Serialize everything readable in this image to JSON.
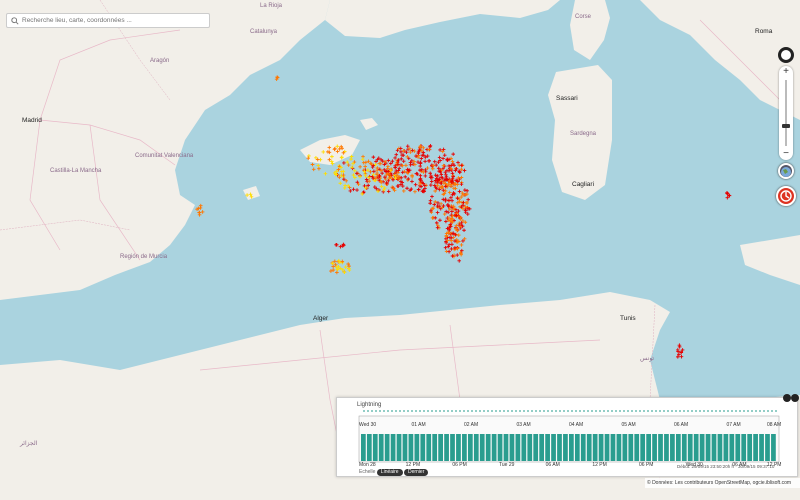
{
  "search": {
    "placeholder": "Recherche lieu, carte, coordonnées ..."
  },
  "map": {
    "labels": {
      "la_rioja": "La Rioja",
      "catalunya": "Catalunya",
      "aragon": "Aragón",
      "madrid": "Madrid",
      "comunitat": "Comunitat Valenciana",
      "castilla": "Castilla-La Mancha",
      "murcia": "Región de Murcia",
      "corse": "Corse",
      "roma": "Roma",
      "sassari": "Sassari",
      "sardegna": "Sardegna",
      "cagliari": "Cagliari",
      "alger": "Alger",
      "tunis": "Tunis",
      "tunisie": "تونس",
      "algerie": "الجزائر"
    },
    "colors": {
      "sea": "#aad3df",
      "land": "#f2efe9",
      "strike_red": "#e60000",
      "strike_orange": "#ff7700",
      "strike_yellow": "#ffdd00"
    }
  },
  "lightning_panel": {
    "title": "Lightning",
    "top_axis": [
      "Wed 30",
      "01 AM",
      "02 AM",
      "03 AM",
      "04 AM",
      "05 AM",
      "06 AM",
      "07 AM",
      "08 AM"
    ],
    "bottom_axis": [
      "Mon 28",
      "12 PM",
      "06 PM",
      "Tue 29",
      "06 AM",
      "12 PM",
      "06 PM",
      "Wed 30",
      "06 AM",
      "12 PM"
    ],
    "scale_label": "Echelle",
    "live_button": "Linéaire",
    "last_button": "Dernier",
    "bar_color": "#2a9d8f",
    "period_text": "Début: 29/09/15 23:50:20h h · 30/09/15 09:37:10"
  },
  "attribution": "© Données: Les contributeurs OpenStreetMap, ogcie.iblisoft.com"
}
